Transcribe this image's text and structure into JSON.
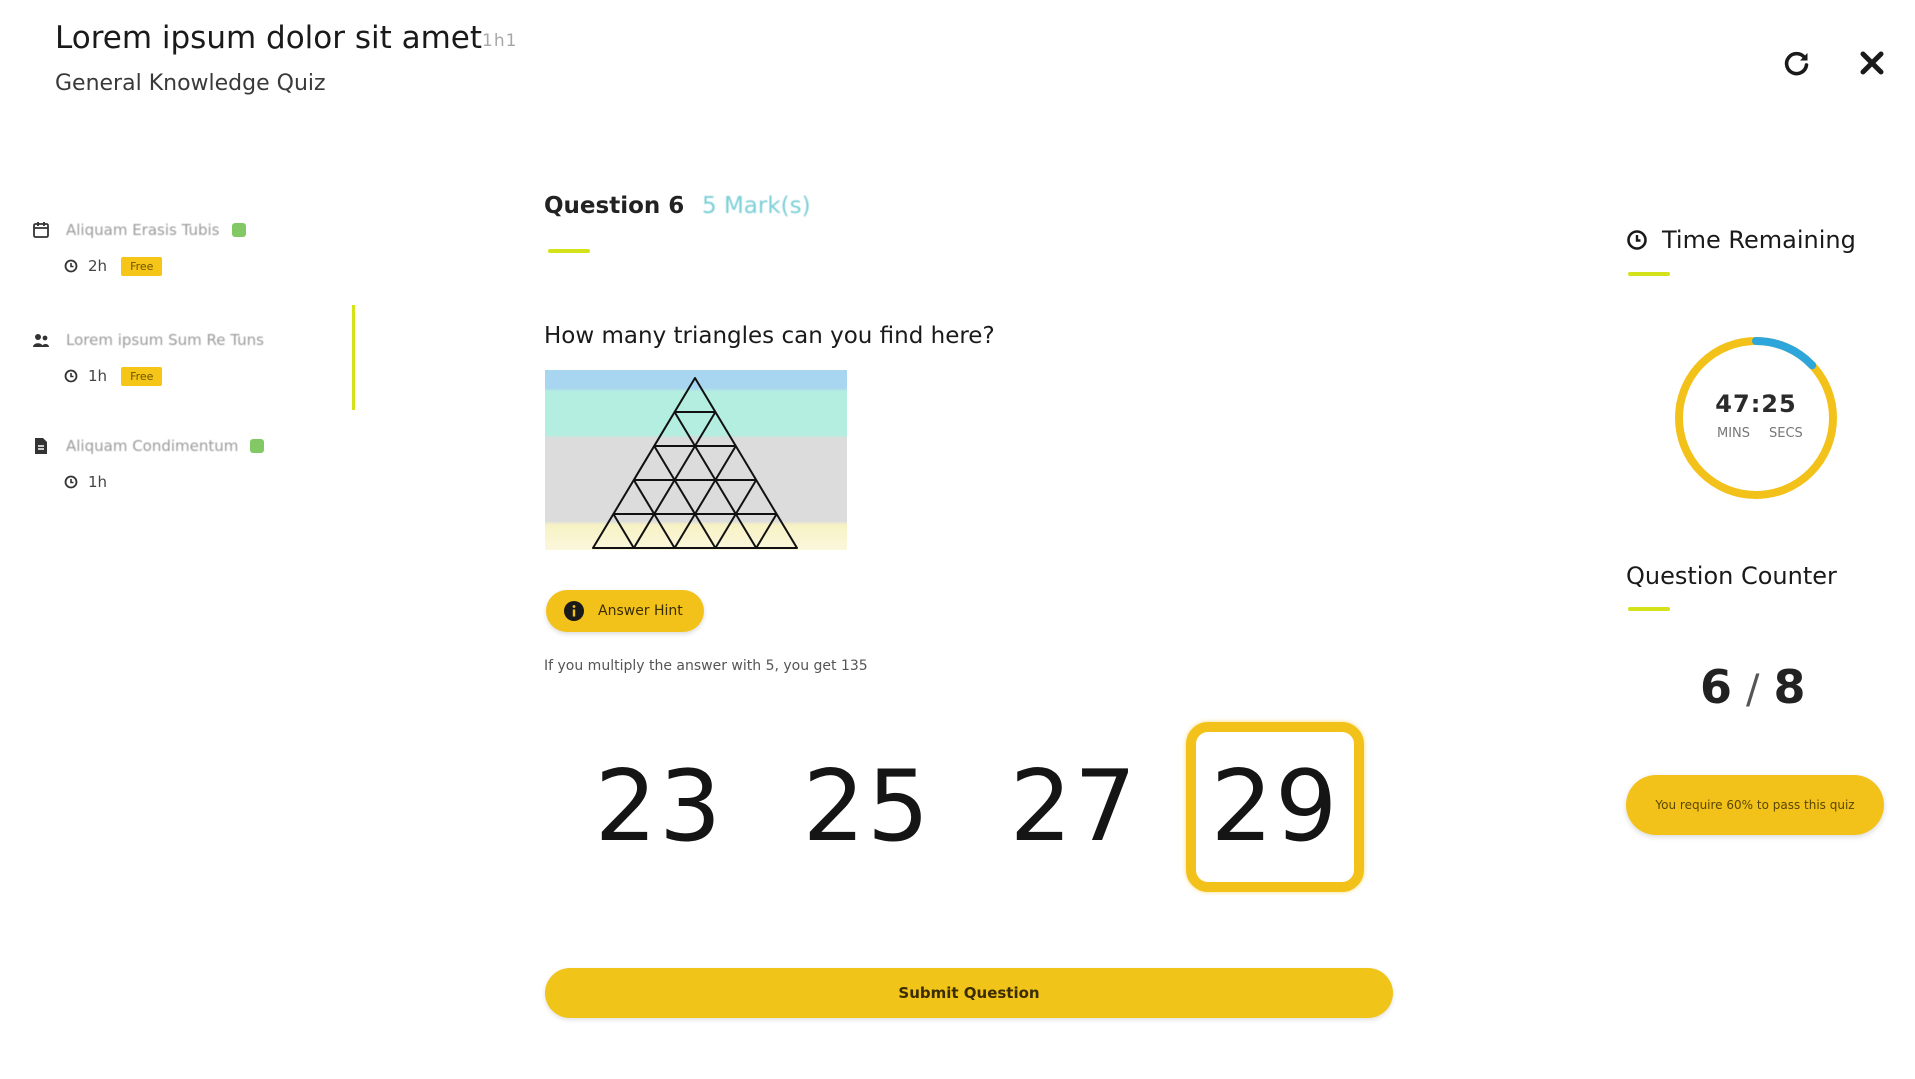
{
  "header": {
    "title": "Lorem ipsum dolor sit amet",
    "title_badge": "1h1",
    "subtitle": "General Knowledge Quiz",
    "icons": [
      "refresh-icon",
      "close-icon"
    ]
  },
  "sidebar": {
    "items": [
      {
        "label": "Aliquam Erasis Tubis",
        "icon": "calendar-icon",
        "completed": true,
        "duration": "2h",
        "badge": "Free"
      },
      {
        "label": "Lorem ipsum Sum Re Tuns",
        "icon": "group-icon",
        "completed": false,
        "duration": "1h",
        "badge": "Free"
      },
      {
        "label": "Aliquam Condimentum",
        "icon": "document-icon",
        "completed": true,
        "duration": "1h",
        "badge": ""
      }
    ]
  },
  "question": {
    "title": "Question 6",
    "marks": "5 Mark(s)",
    "text": "How many triangles can you find here?",
    "hint_button": "Answer Hint",
    "hint_text": "If you multiply the answer with 5, you get 135",
    "options": [
      "23",
      "25",
      "27",
      "29"
    ],
    "selected_index": 3,
    "submit_label": "Submit Question"
  },
  "right_panel": {
    "time_heading": "Time Remaining",
    "time_value": "47:25",
    "mins_label": "MINS",
    "secs_label": "SECS",
    "time_remaining_fraction": 0.87,
    "counter_heading": "Question Counter",
    "counter_current": "6",
    "counter_sep": "/",
    "counter_total": "8",
    "pass_text": "You require 60% to pass this quiz"
  },
  "colors": {
    "accent_yellow": "#f3c21a",
    "accent_lime": "#d4e21a",
    "timer_blue": "#2da6dc",
    "marks_teal": "#7bcfd6"
  }
}
